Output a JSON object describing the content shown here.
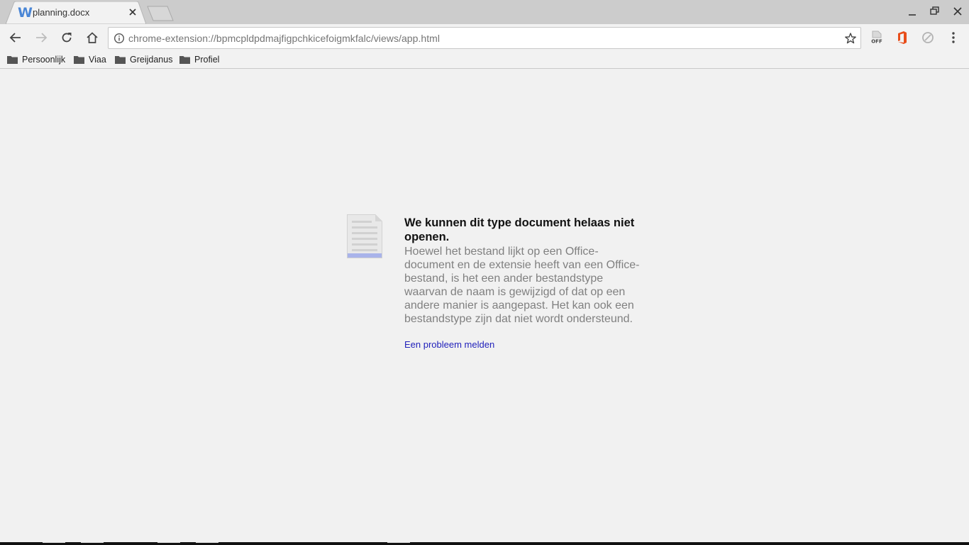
{
  "tabs": [
    {
      "title": "planning.docx",
      "favicon": "word-icon",
      "favicon_glyph": "W",
      "active": true
    }
  ],
  "toolbar": {
    "url": "chrome-extension://bpmcpldpdmajfigpchkicefoigmkfalc/views/app.html"
  },
  "extensions": [
    "office-off-extension-icon",
    "office-extension-icon",
    "blocked-extension-icon"
  ],
  "extension_labels": {
    "office_off": "OFF"
  },
  "bookmarks": [
    {
      "label": "Persoonlijk"
    },
    {
      "label": "Viaa"
    },
    {
      "label": "Greijdanus"
    },
    {
      "label": "Profiel"
    }
  ],
  "error": {
    "title": "We kunnen dit type document helaas niet openen.",
    "body": "Hoewel het bestand lijkt op een Office-document en de extensie heeft van een Office-bestand, is het een ander bestandstype waarvan de naam is gewijzigd of dat op een andere manier is aangepast. Het kan ook een bestandstype zijn dat niet wordt ondersteund.",
    "link": "Een probleem melden"
  },
  "colors": {
    "accent_word": "#4a86d6",
    "office_orange": "#e84e1b",
    "link": "#2222bb"
  }
}
